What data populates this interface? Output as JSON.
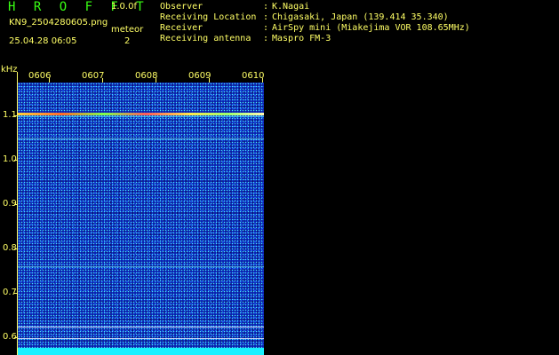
{
  "header": {
    "app_title": "H R O F F T",
    "version": "1.0.0f",
    "filename": "KN9_2504280605.png",
    "meteor_label": "meteor",
    "meteor_count": "2",
    "datetime": "25.04.28 06:05"
  },
  "info": [
    {
      "label": "Observer",
      "value": "K.Nagai"
    },
    {
      "label": "Receiving Location",
      "value": "Chigasaki, Japan (139.414 35.340)"
    },
    {
      "label": "Receiver",
      "value": "AirSpy mini (Miakejima VOR 108.65MHz)"
    },
    {
      "label": "Receiving antenna",
      "value": "Maspro FM-3"
    }
  ],
  "info_separator": ":",
  "axis": {
    "unit": "kHz",
    "y_ticks": [
      "1.1",
      "1.0",
      "0.9",
      "0.8",
      "0.7",
      "0.6"
    ],
    "time_labels": [
      "0606",
      "0607",
      "0608",
      "0609",
      "0610"
    ]
  },
  "colors": {
    "text": "#ffff66",
    "title": "#39ff14",
    "background": "#000000",
    "spectrum_base": "#0b1fae",
    "noise_band": "#19f0ff"
  }
}
